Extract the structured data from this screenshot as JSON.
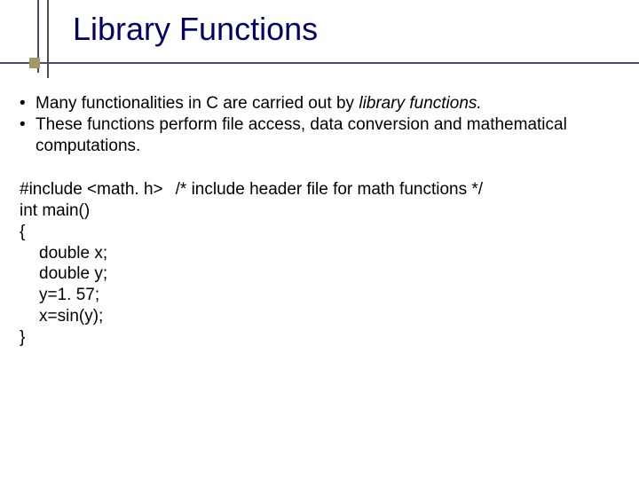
{
  "slide": {
    "title": "Library Functions",
    "bullets": [
      {
        "prefix": "• ",
        "text_a": "Many functionalities in C are carried out by ",
        "italic": "library functions.",
        "text_b": ""
      },
      {
        "prefix": "• ",
        "text_a": "These functions perform file access, data conversion and mathematical computations.",
        "italic": "",
        "text_b": ""
      }
    ],
    "code": {
      "line1_a": "#include <math. h>",
      "line1_b": "/* include header file for math functions */",
      "line2": "int main()",
      "line3": "{",
      "line4": "double x;",
      "line5": "double y;",
      "line6": "y=1. 57;",
      "line7": "x=sin(y);",
      "line8": "}"
    }
  }
}
